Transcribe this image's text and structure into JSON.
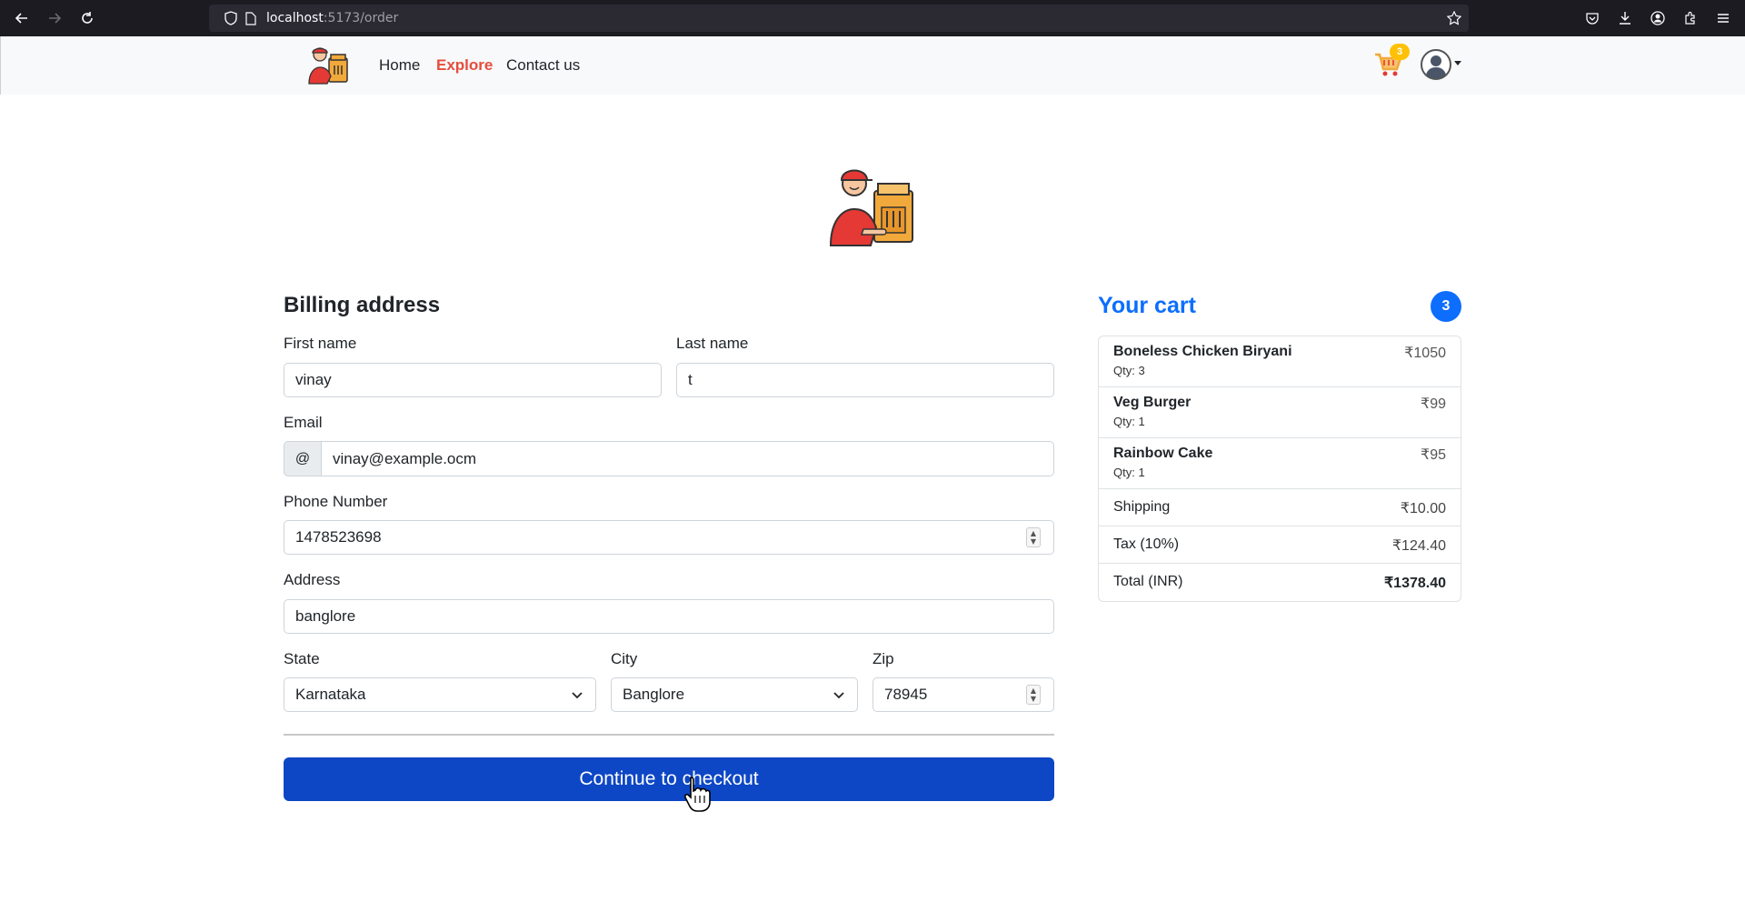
{
  "browser": {
    "url_host": "localhost",
    "url_path": ":5173/order"
  },
  "navbar": {
    "links": [
      {
        "label": "Home"
      },
      {
        "label": "Explore"
      },
      {
        "label": "Contact us"
      }
    ],
    "cart_count": "3",
    "accent_color": "#e74c3c"
  },
  "billing": {
    "title": "Billing address",
    "first_name": {
      "label": "First name",
      "value": "vinay"
    },
    "last_name": {
      "label": "Last name",
      "value": "t"
    },
    "email": {
      "label": "Email",
      "addon": "@",
      "value": "vinay@example.ocm"
    },
    "phone": {
      "label": "Phone Number",
      "value": "1478523698"
    },
    "address": {
      "label": "Address",
      "value": "banglore"
    },
    "state": {
      "label": "State",
      "value": "Karnataka"
    },
    "city": {
      "label": "City",
      "value": "Banglore"
    },
    "zip": {
      "label": "Zip",
      "value": "78945"
    },
    "checkout_label": "Continue to checkout",
    "button_color": "#0d47c5"
  },
  "cart": {
    "title": "Your cart",
    "count": "3",
    "items": [
      {
        "name": "Boneless Chicken Biryani",
        "qty": "Qty: 3",
        "price": "₹1050"
      },
      {
        "name": "Veg Burger",
        "qty": "Qty: 1",
        "price": "₹99"
      },
      {
        "name": "Rainbow Cake",
        "qty": "Qty: 1",
        "price": "₹95"
      }
    ],
    "shipping": {
      "label": "Shipping",
      "value": "₹10.00"
    },
    "tax": {
      "label": "Tax (10%)",
      "value": "₹124.40"
    },
    "total": {
      "label": "Total (INR)",
      "value": "₹1378.40"
    },
    "accent_color": "#0d6efd"
  }
}
